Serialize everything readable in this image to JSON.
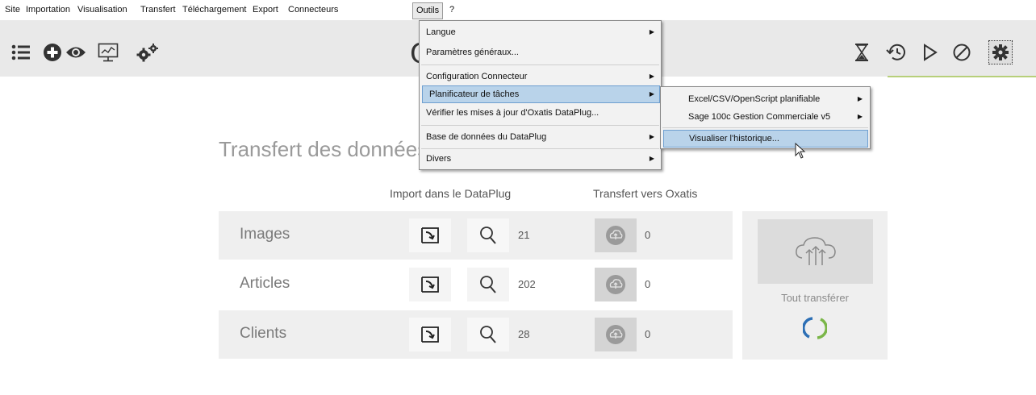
{
  "menubar": {
    "items": [
      "Site",
      "Importation",
      "Visualisation",
      "Transfert",
      "Téléchargement",
      "Export",
      "Connecteurs",
      "Outils",
      "?"
    ]
  },
  "toolbar": {
    "left_icons": [
      "list-icon",
      "add-circle-icon",
      "eye-icon",
      "monitor-chart-icon",
      "gears-icon"
    ],
    "right_icons": [
      "hourglass-icon",
      "history-icon",
      "play-icon",
      "cancel-icon",
      "settings-icon"
    ],
    "logo_partial": "C"
  },
  "outils_menu": {
    "items": [
      {
        "label": "Langue",
        "submenu": true
      },
      {
        "label": "Paramètres généraux...",
        "submenu": false
      },
      {
        "label": "Configuration Connecteur",
        "submenu": true
      },
      {
        "label": "Planificateur de tâches",
        "submenu": true,
        "highlighted": true
      },
      {
        "label": "Vérifier les mises à jour d'Oxatis DataPlug...",
        "submenu": false
      },
      {
        "label": "Base de données du DataPlug",
        "submenu": true
      },
      {
        "label": "Divers",
        "submenu": true
      }
    ]
  },
  "planificateur_submenu": {
    "items": [
      {
        "label": "Excel/CSV/OpenScript planifiable",
        "submenu": true
      },
      {
        "label": "Sage 100c Gestion Commerciale v5",
        "submenu": true
      },
      {
        "label": "Visualiser l'historique...",
        "submenu": false,
        "highlighted": true
      }
    ]
  },
  "main": {
    "title": "Transfert des données",
    "col_import": "Import dans le DataPlug",
    "col_transfer": "Transfert vers Oxatis",
    "rows": [
      {
        "label": "Images",
        "import_count": "21",
        "transfer_count": "0"
      },
      {
        "label": "Articles",
        "import_count": "202",
        "transfer_count": "0"
      },
      {
        "label": "Clients",
        "import_count": "28",
        "transfer_count": "0"
      }
    ],
    "transfer_all_label": "Tout transférer"
  },
  "colors": {
    "highlight": "#b9d3ea",
    "accent_green": "#7ab648",
    "accent_blue": "#2c6fb5"
  }
}
